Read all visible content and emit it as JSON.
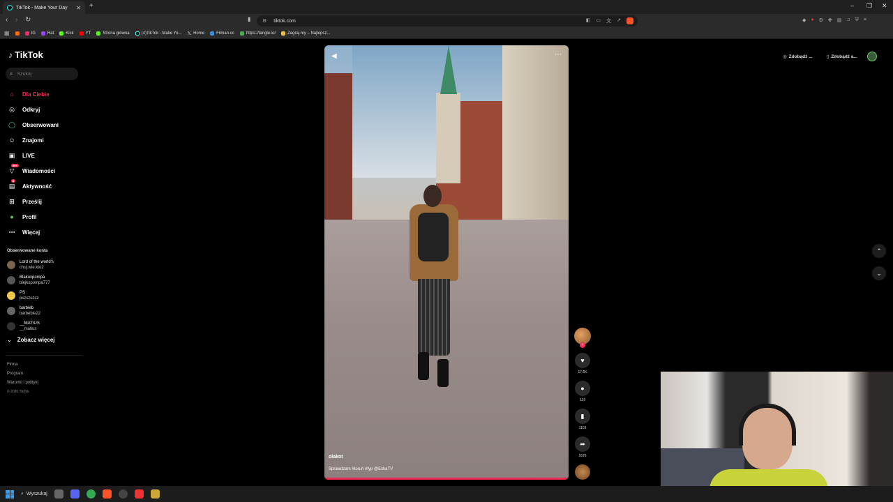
{
  "browser": {
    "tab_title": "TikTok - Make Your Day",
    "new_tab": "+",
    "url": "tiktok.com",
    "bookmarks": [
      "IG",
      "Rat",
      "Kick",
      "YT",
      "Strona główna",
      "(4)TikTok - Make Yo...",
      "Home",
      "Filman.cc",
      "https://tangle.io/",
      "Zagraj.my – Najlepsz..."
    ],
    "bookmark_colors": [
      "#e1306c",
      "#e1306c",
      "#53fc18",
      "#ff0000",
      "#53fc18",
      "#25f4ee",
      "#ffffff",
      "#3a8fd9",
      "#4caf50",
      "#f5c542"
    ]
  },
  "tiktok": {
    "logo": "TikTok",
    "search_placeholder": "Szukaj",
    "nav": [
      {
        "label": "Dla Ciebie",
        "icon": "home-icon",
        "active": true
      },
      {
        "label": "Odkryj",
        "icon": "compass-icon"
      },
      {
        "label": "Obserwowani",
        "icon": "following-icon"
      },
      {
        "label": "Znajomi",
        "icon": "friends-icon"
      },
      {
        "label": "LIVE",
        "icon": "live-icon"
      },
      {
        "label": "Wiadomości",
        "icon": "messages-icon",
        "badge": "99+"
      },
      {
        "label": "Aktywność",
        "icon": "activity-icon",
        "badge": "8"
      },
      {
        "label": "Prześlij",
        "icon": "upload-icon"
      },
      {
        "label": "Profil",
        "icon": "profile-icon"
      },
      {
        "label": "Więcej",
        "icon": "more-icon"
      }
    ],
    "followed_title": "Obserwowane konta",
    "followed_accounts": [
      {
        "name": "Lord of the world's",
        "user": "chuj.wie.kto2"
      },
      {
        "name": "Blakuxpompa",
        "user": "blejkxpompa777"
      },
      {
        "name": "PS",
        "user": "pszszszsz"
      },
      {
        "name": "barbieb",
        "user": "barbebie22"
      },
      {
        "name": "__MATIUS",
        "user": "__matius"
      }
    ],
    "see_more": "Zobacz więcej",
    "footer": [
      "Firma",
      "Program",
      "Warunki i polityki"
    ],
    "copyright": "© 2026 TikTok",
    "top_right": {
      "coins": "Zdobądź ...",
      "app": "Zdobądź a..."
    },
    "video": {
      "author": "olakot",
      "caption": "Sprawdzam #toruń #fyp @EskaTV",
      "progress": 1.0
    },
    "actions": {
      "likes": "17.6K",
      "comments": "119",
      "saves": "1103",
      "shares": "1676"
    }
  },
  "taskbar": {
    "search_label": "Wyszukaj"
  }
}
